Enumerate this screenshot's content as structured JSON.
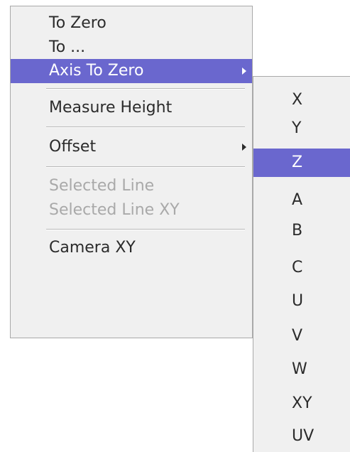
{
  "main_menu": {
    "items": [
      {
        "label": "To Zero"
      },
      {
        "label": "To ..."
      },
      {
        "label": "Axis To Zero",
        "state": "highlighted",
        "has_submenu": true
      },
      {
        "label": "Measure Height"
      },
      {
        "label": "Offset",
        "has_submenu": true
      },
      {
        "label": "Selected Line",
        "state": "disabled"
      },
      {
        "label": "Selected Line XY",
        "state": "disabled"
      },
      {
        "label": "Camera XY"
      }
    ]
  },
  "axis_submenu": {
    "items": [
      {
        "label": "X"
      },
      {
        "label": "Y"
      },
      {
        "label": "Z",
        "state": "highlighted"
      },
      {
        "label": "A"
      },
      {
        "label": "B"
      },
      {
        "label": "C"
      },
      {
        "label": "U"
      },
      {
        "label": "V"
      },
      {
        "label": "W"
      },
      {
        "label": "XY"
      },
      {
        "label": "UV"
      }
    ]
  },
  "colors": {
    "highlight": "#6a67ce",
    "menu_background": "#f0f0f0",
    "text": "#2b2b2b",
    "disabled_text": "#a9a9a9",
    "border": "#a9a9a9"
  },
  "icons": {
    "submenu_arrow": "caret-right-icon"
  }
}
